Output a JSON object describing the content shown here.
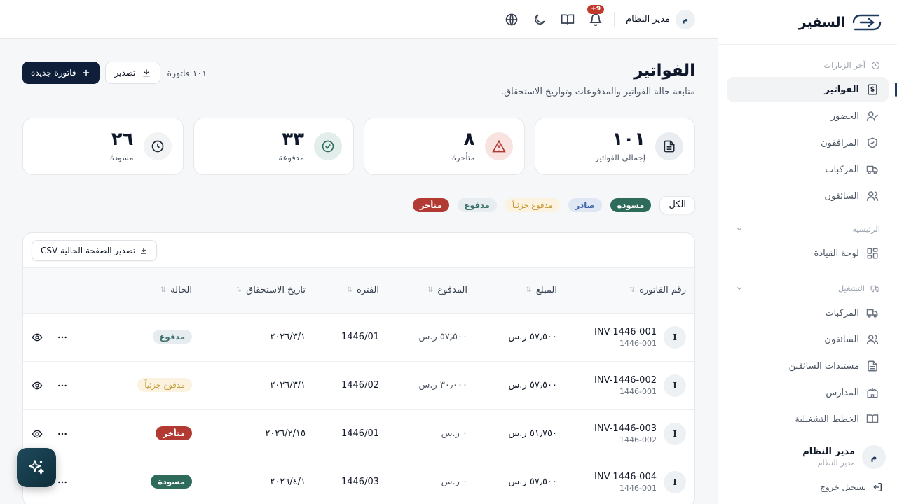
{
  "brand": {
    "name": "السفير"
  },
  "sidebar": {
    "recent_label": "آخر الزيارات",
    "recent_items": [
      {
        "label": "الفواتير",
        "icon": "invoice-icon"
      },
      {
        "label": "الحضور",
        "icon": "user-check-icon"
      },
      {
        "label": "المرافقون",
        "icon": "shield-icon"
      },
      {
        "label": "المركبات",
        "icon": "truck-icon"
      },
      {
        "label": "السائقون",
        "icon": "users-icon"
      }
    ],
    "main_label": "الرئيسية",
    "main_items": [
      {
        "label": "لوحة القيادة",
        "icon": "dashboard-icon"
      }
    ],
    "ops_label": "التشغيل",
    "ops_items": [
      {
        "label": "المركبات",
        "icon": "truck-icon"
      },
      {
        "label": "السائقون",
        "icon": "users-icon"
      },
      {
        "label": "مستندات السائقين",
        "icon": "document-icon"
      },
      {
        "label": "المدارس",
        "icon": "school-icon"
      },
      {
        "label": "الخطط التشغيلية",
        "icon": "book-icon"
      }
    ],
    "user": {
      "initial": "م",
      "name": "مدير النظام",
      "role": "مدير النظام"
    },
    "logout_label": "تسجيل خروج"
  },
  "topbar": {
    "user_name": "مدير النظام",
    "user_initial": "م",
    "notifications": "9+"
  },
  "page": {
    "title": "الفواتير",
    "subtitle": "متابعة حالة الفواتير والمدفوعات وتواريخ الاستحقاق.",
    "new_invoice": "فاتورة جديدة",
    "export": "تصدير",
    "count": "١٠١ فاتورة"
  },
  "stats": [
    {
      "value": "١٠١",
      "label": "إجمالي الفواتير",
      "icon": "document-icon"
    },
    {
      "value": "٨",
      "label": "متأخرة",
      "icon": "warning-icon"
    },
    {
      "value": "٣٣",
      "label": "مدفوعة",
      "icon": "check-circle-icon"
    },
    {
      "value": "٢٦",
      "label": "مسودة",
      "icon": "clock-icon"
    }
  ],
  "filters": {
    "all": "الكل",
    "draft": "مسودة",
    "issued": "صادر",
    "partial": "مدفوع جزئياً",
    "paid": "مدفوع",
    "late": "متأخر"
  },
  "table": {
    "export_csv": "تصدير الصفحة الحالية CSV",
    "columns": [
      "رقم الفاتورة",
      "المبلغ",
      "المدفوع",
      "الفترة",
      "تاريخ الاستحقاق",
      "الحالة"
    ],
    "rows": [
      {
        "initial": "I",
        "invoice": "INV-1446-001",
        "sub": "1446-001",
        "amount": "٥٧٫٥٠٠ ر.س",
        "paid": "٥٧٫٥٠٠ ر.س",
        "period": "1446/01",
        "due": "٢٠٢٦/٣/١",
        "status": "مدفوع",
        "status_key": "paid"
      },
      {
        "initial": "I",
        "invoice": "INV-1446-002",
        "sub": "1446-001",
        "amount": "٥٧٫٥٠٠ ر.س",
        "paid": "٣٠٫٠٠٠ ر.س",
        "period": "1446/02",
        "due": "٢٠٢٦/٣/١",
        "status": "مدفوع جزئياً",
        "status_key": "partial"
      },
      {
        "initial": "I",
        "invoice": "INV-1446-003",
        "sub": "1446-002",
        "amount": "٥١٫٧٥٠ ر.س",
        "paid": "٠ ر.س",
        "period": "1446/01",
        "due": "٢٠٢٦/٢/١٥",
        "status": "متأخر",
        "status_key": "late"
      },
      {
        "initial": "I",
        "invoice": "INV-1446-004",
        "sub": "1446-001",
        "amount": "٥٧٫٥٠٠ ر.س",
        "paid": "٠ ر.س",
        "period": "1446/03",
        "due": "٢٠٢٦/٤/١",
        "status": "مسودة",
        "status_key": "draft"
      }
    ]
  },
  "colors": {
    "primary": "#0f1f3a",
    "draft": "#2f6b5a",
    "late": "#b23a32",
    "issued": "#4066a6",
    "partial": "#c69a3b"
  }
}
